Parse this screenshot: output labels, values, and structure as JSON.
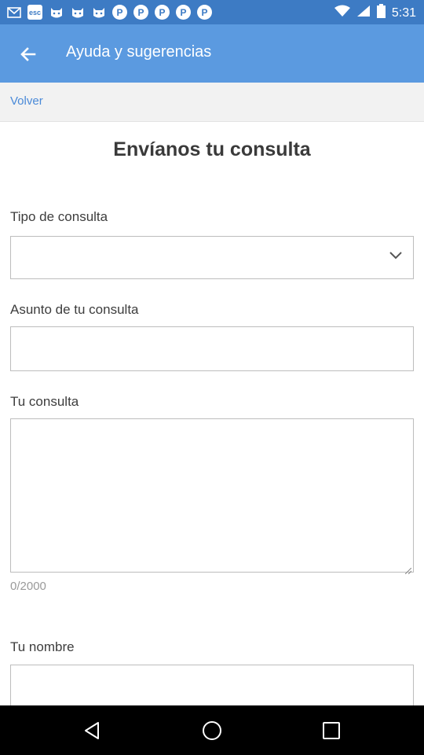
{
  "status_bar": {
    "left_icons": [
      "mail-icon",
      "esc-app-icon",
      "cat-icon",
      "cat-icon",
      "cat-icon",
      "pinterest-icon",
      "pinterest-icon",
      "pinterest-icon",
      "pinterest-icon",
      "pinterest-icon"
    ],
    "esc_label": "esc",
    "time": "5:31"
  },
  "app_bar": {
    "title": "Ayuda y sugerencias",
    "color": "#5b9ae0"
  },
  "volver": {
    "label": "Volver"
  },
  "form": {
    "heading": "Envíanos tu consulta",
    "tipo_label": "Tipo de consulta",
    "tipo_value": "",
    "asunto_label": "Asunto de tu consulta",
    "asunto_value": "",
    "consulta_label": "Tu consulta",
    "consulta_value": "",
    "char_count": "0/2000",
    "nombre_label": "Tu nombre",
    "nombre_value": ""
  },
  "colors": {
    "status_bar": "#3d7bc4",
    "link": "#4a8ad8",
    "nav_bar": "#000000"
  }
}
